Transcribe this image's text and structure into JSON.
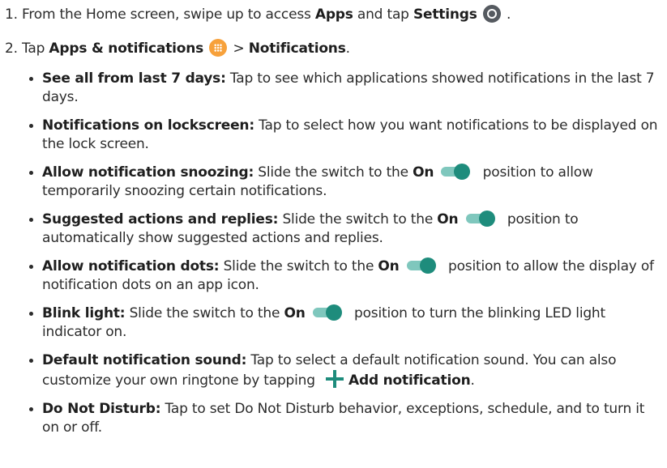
{
  "step1": {
    "number": "1.",
    "text_before": " From the Home screen, swipe up to access ",
    "bold_apps": "Apps",
    "text_mid": " and tap ",
    "bold_settings": "Settings",
    "text_after": " ."
  },
  "step2": {
    "number": "2.",
    "text_before": " Tap ",
    "bold_apps_notifications": "Apps & notifications",
    "text_sep": " > ",
    "bold_notifications": "Notifications",
    "text_after": "."
  },
  "items": [
    {
      "title": "See all from last 7 days:",
      "text": " Tap to see which applications showed notifications in the last 7 days."
    },
    {
      "title": "Notifications on lockscreen:",
      "text": " Tap to select how you want notifications to be displayed on the lock screen."
    },
    {
      "title": "Allow notification snoozing:",
      "before": " Slide the switch to the ",
      "on": "On",
      "after": " position to allow temporarily snoozing certain notifications."
    },
    {
      "title": "Suggested actions and replies:",
      "before": " Slide the switch to the ",
      "on": "On",
      "after": " position to automatically show suggested actions and replies."
    },
    {
      "title": "Allow notification dots:",
      "before": " Slide the switch to the ",
      "on": "On",
      "after": " position to allow the display of notification dots on an app icon."
    },
    {
      "title": "Blink light:",
      "before": " Slide the switch to the ",
      "on": "On",
      "after": " position to turn the blinking LED light indicator on."
    },
    {
      "title": "Default notification sound:",
      "before": " Tap to select a default notification sound. You can also customize your own ringtone by tapping ",
      "bold_end": "Add notification",
      "after": "."
    },
    {
      "title": "Do Not Disturb:",
      "text": " Tap to set Do Not Disturb behavior, exceptions, schedule, and to turn it on or off."
    }
  ],
  "colors": {
    "toggle_track": "#7fc7bd",
    "toggle_knob": "#1e8c7c",
    "apps_icon": "#f7a13b",
    "settings_icon": "#555a60",
    "plus_icon": "#1e8c7c"
  },
  "icons": {
    "settings": "settings-icon",
    "apps": "apps-icon",
    "toggle": "toggle-on-icon",
    "plus": "plus-icon"
  }
}
